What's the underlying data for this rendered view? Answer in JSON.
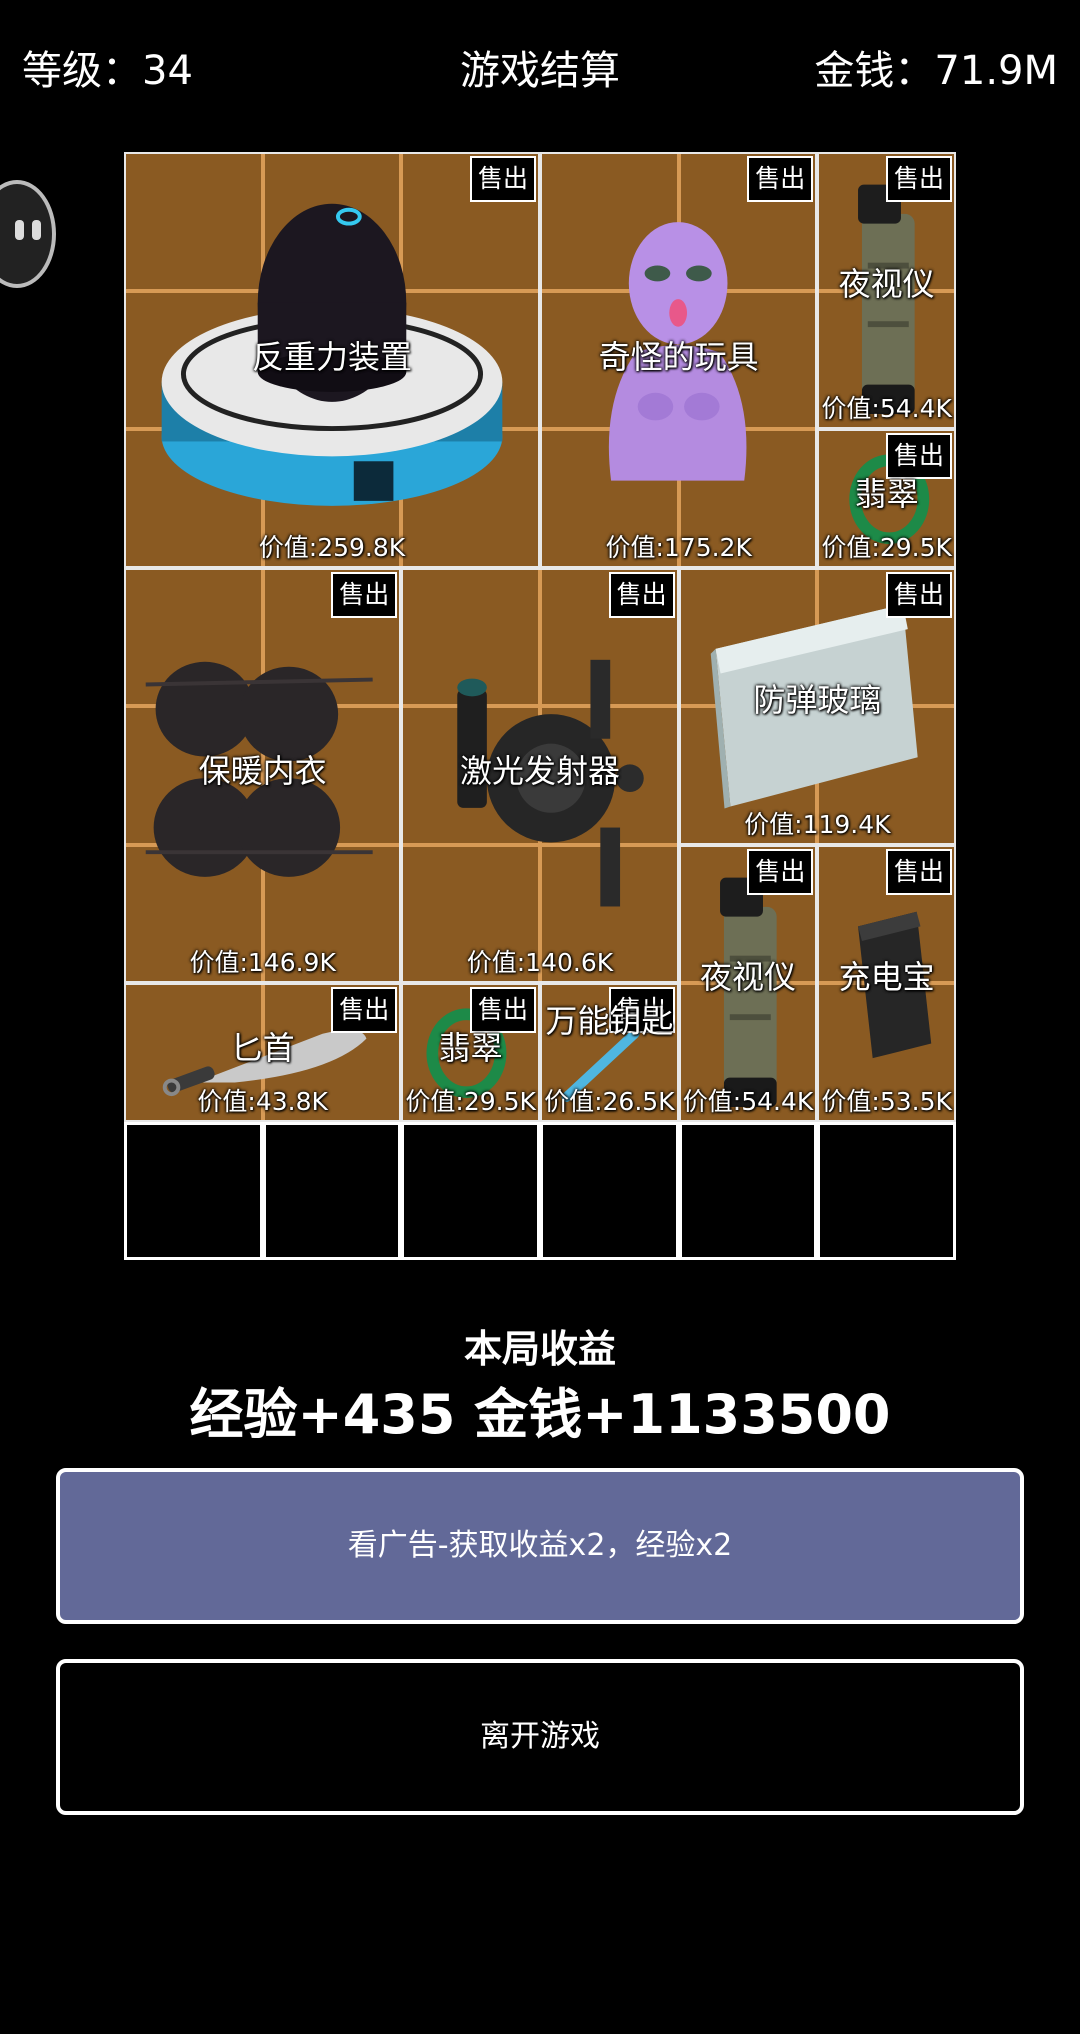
{
  "header": {
    "level": "等级：34",
    "title": "游戏结算",
    "money": "金钱：71.9M"
  },
  "sell_label": "售出",
  "items": [
    {
      "name": "反重力装置",
      "value": "价值:259.8K",
      "icon": "anti-gravity-device-icon"
    },
    {
      "name": "奇怪的玩具",
      "value": "价值:175.2K",
      "icon": "strange-toy-icon"
    },
    {
      "name": "夜视仪",
      "value": "价值:54.4K",
      "icon": "night-vision-icon"
    },
    {
      "name": "翡翠",
      "value": "价值:29.5K",
      "icon": "jade-bracelet-icon"
    },
    {
      "name": "保暖内衣",
      "value": "价值:146.9K",
      "icon": "thermal-underwear-icon"
    },
    {
      "name": "激光发射器",
      "value": "价值:140.6K",
      "icon": "laser-emitter-icon"
    },
    {
      "name": "防弹玻璃",
      "value": "价值:119.4K",
      "icon": "bulletproof-glass-icon"
    },
    {
      "name": "夜视仪",
      "value": "价值:54.4K",
      "icon": "night-vision-icon"
    },
    {
      "name": "充电宝",
      "value": "价值:53.5K",
      "icon": "power-bank-icon"
    },
    {
      "name": "匕首",
      "value": "价值:43.8K",
      "icon": "dagger-icon"
    },
    {
      "name": "翡翠",
      "value": "价值:29.5K",
      "icon": "jade-bracelet-icon"
    },
    {
      "name": "万能钥匙",
      "value": "价值:26.5K",
      "icon": "master-key-icon"
    }
  ],
  "rewards": {
    "title": "本局收益",
    "text": "经验+435 金钱+1133500"
  },
  "buttons": {
    "ad": "看广告-获取收益x2，经验x2",
    "leave": "离开游戏"
  },
  "colors": {
    "cell_fill": "#8a5a22",
    "cell_line": "#d79a55",
    "ad_button": "#626998"
  }
}
